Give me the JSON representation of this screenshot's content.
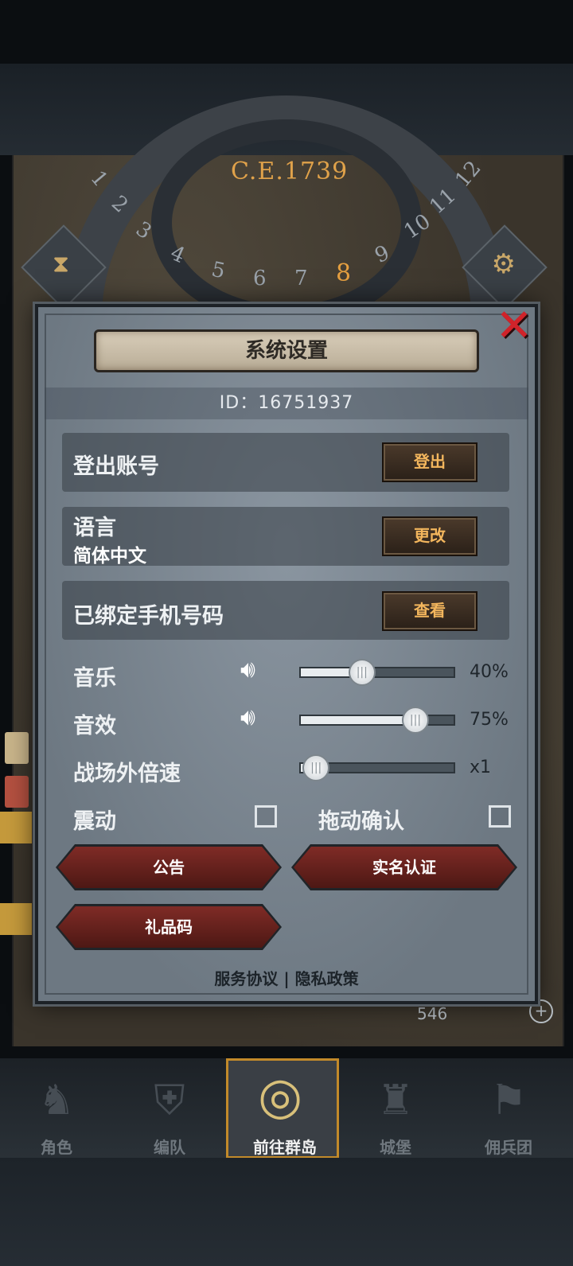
{
  "map": {
    "year": "C.E.1739",
    "ring_numbers": [
      "1",
      "2",
      "3",
      "4",
      "5",
      "6",
      "7",
      "8",
      "9",
      "10",
      "11",
      "12"
    ],
    "active_number": "8",
    "gems": "546"
  },
  "dialog": {
    "title": "系统设置",
    "id_text": "ID：16751937",
    "rows": {
      "logout": {
        "label": "登出账号",
        "button": "登出"
      },
      "language": {
        "label": "语言",
        "value": "简体中文",
        "button": "更改"
      },
      "phone": {
        "label": "已绑定手机号码",
        "button": "查看"
      }
    },
    "sliders": {
      "music": {
        "label": "音乐",
        "value_text": "40%",
        "fraction": 0.4
      },
      "sfx": {
        "label": "音效",
        "value_text": "75%",
        "fraction": 0.75
      },
      "speed": {
        "label": "战场外倍速",
        "value_text": "x1",
        "fraction": 0.1
      }
    },
    "toggles": {
      "vibrate": {
        "label": "震动",
        "checked": false
      },
      "drag_confirm": {
        "label": "拖动确认",
        "checked": false
      }
    },
    "buttons": {
      "notice": "公告",
      "realname": "实名认证",
      "giftcode": "礼品码"
    },
    "footer": {
      "terms": "服务协议",
      "separator": "|",
      "privacy": "隐私政策"
    }
  },
  "nav": [
    {
      "label": "角色",
      "icon": "knight-icon"
    },
    {
      "label": "编队",
      "icon": "helmet-icon"
    },
    {
      "label": "前往群岛",
      "icon": "globe-icon",
      "active": true
    },
    {
      "label": "城堡",
      "icon": "castle-icon"
    },
    {
      "label": "佣兵团",
      "icon": "banner-icon"
    }
  ],
  "colors": {
    "accent_gold": "#f3b65d",
    "close_red": "#d0232a",
    "nav_active_border": "#c28a2a"
  }
}
